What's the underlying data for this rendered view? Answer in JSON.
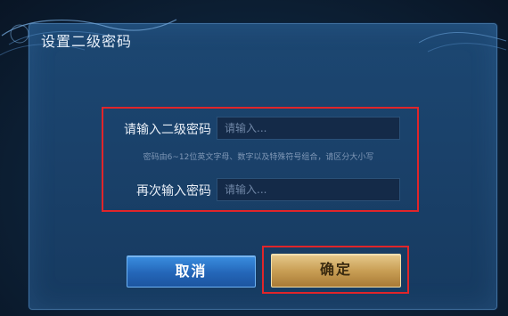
{
  "dialog": {
    "title": "设置二级密码"
  },
  "form": {
    "password_label": "请输入二级密码",
    "password_placeholder": "请输入...",
    "hint": "密码由6~12位英文字母、数字以及特殊符号组合，请区分大小写",
    "confirm_label": "再次输入密码",
    "confirm_placeholder": "请输入..."
  },
  "buttons": {
    "cancel_label": "取消",
    "confirm_label": "确定"
  },
  "colors": {
    "highlight": "#e0252a",
    "cancel_button": "#2466b8",
    "confirm_button": "#c99f55"
  }
}
